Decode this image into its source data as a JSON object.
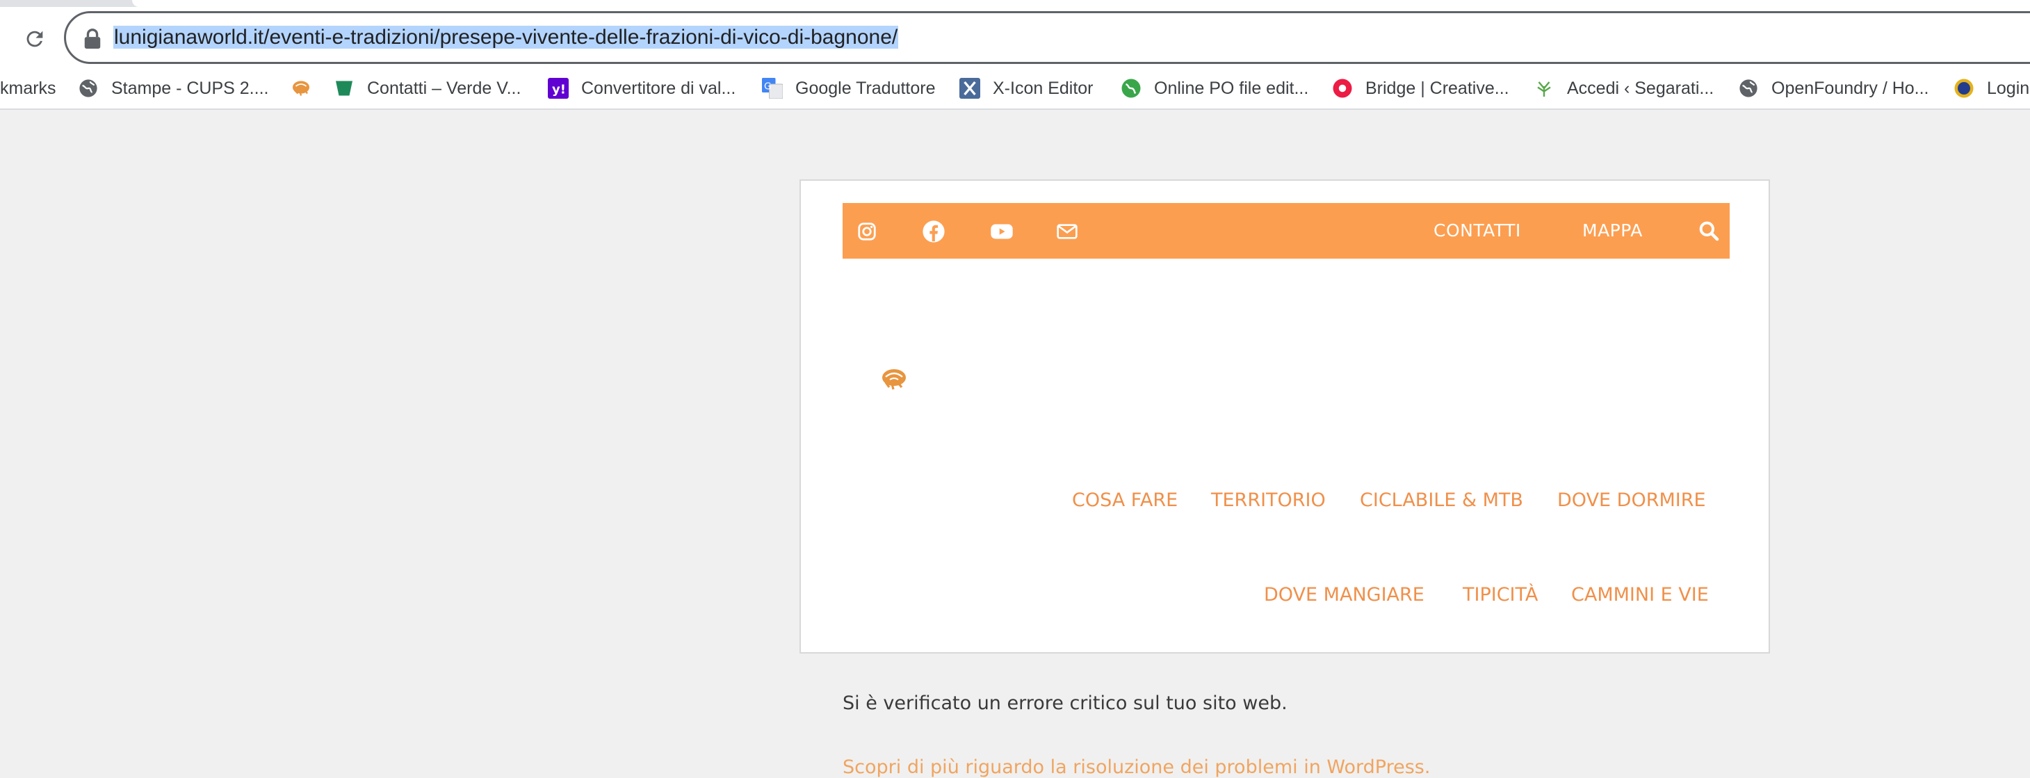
{
  "browser": {
    "url_highlighted": "lunigianaworld.it/eventi-e-tradizioni/presepe-vivente-delle-frazioni-di-vico-di-bagnone/",
    "bookmarks": [
      {
        "label": "kmarks",
        "icon": "none"
      },
      {
        "label": "Stampe - CUPS 2....",
        "icon": "globe-icon"
      },
      {
        "label": "",
        "icon": "lunigiana-favicon-icon"
      },
      {
        "label": "Contatti – Verde V...",
        "icon": "green-shield-icon"
      },
      {
        "label": "Convertitore di val...",
        "icon": "yahoo-icon"
      },
      {
        "label": "Google Traduttore",
        "icon": "google-translate-icon"
      },
      {
        "label": "X-Icon Editor",
        "icon": "x-icon-editor-icon"
      },
      {
        "label": "Online PO file edit...",
        "icon": "green-globe-icon"
      },
      {
        "label": "Bridge | Creative...",
        "icon": "red-circle-icon"
      },
      {
        "label": "Accedi ‹ Segarati...",
        "icon": "tree-icon"
      },
      {
        "label": "OpenFoundry / Ho...",
        "icon": "globe-icon"
      },
      {
        "label": "Login",
        "icon": "lions-icon"
      }
    ]
  },
  "site": {
    "accent_color": "#fc9e50",
    "topbar": {
      "social_icons": [
        "instagram-icon",
        "facebook-icon",
        "youtube-icon",
        "mail-icon"
      ],
      "links": [
        "CONTATTI",
        "MAPPA"
      ],
      "search_icon": "search-icon"
    },
    "main_nav_row1": [
      "COSA FARE",
      "TERRITORIO",
      "CICLABILE & MTB",
      "DOVE DORMIRE"
    ],
    "main_nav_row2": [
      "DOVE MANGIARE",
      "TIPICITÀ",
      "CAMMINI E VIE"
    ],
    "error_message": "Si è verificato un errore critico sul tuo sito web.",
    "help_link": "Scopri di più riguardo la risoluzione dei problemi in WordPress."
  }
}
